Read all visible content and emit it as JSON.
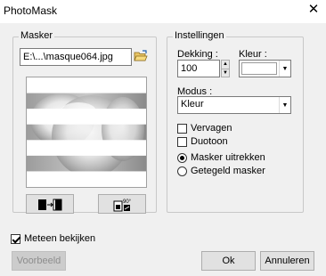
{
  "window": {
    "title": "PhotoMask"
  },
  "masker": {
    "group_label": "Masker",
    "file_value": "E:\\...\\masque064.jpg",
    "stripes": [
      true,
      false,
      true,
      false,
      true,
      false,
      true
    ]
  },
  "settings": {
    "group_label": "Instellingen",
    "dekking_label": "Dekking :",
    "dekking_value": "100",
    "kleur_label": "Kleur :",
    "modus_label": "Modus :",
    "modus_value": "Kleur",
    "vervagen_label": "Vervagen",
    "vervagen_checked": false,
    "duotoon_label": "Duotoon",
    "duotoon_checked": false,
    "radio_options": [
      {
        "label": "Masker uitrekken",
        "selected": true
      },
      {
        "label": "Getegeld masker",
        "selected": false
      }
    ]
  },
  "footer": {
    "meteen_label": "Meteen bekijken",
    "meteen_checked": true,
    "voorbeeld_label": "Voorbeeld",
    "ok_label": "Ok",
    "annuleren_label": "Annuleren"
  },
  "colors": {
    "dialog_bg": "#f0f0f0",
    "button_bg": "#e1e1e1",
    "disabled_text": "#8d8d8d"
  }
}
